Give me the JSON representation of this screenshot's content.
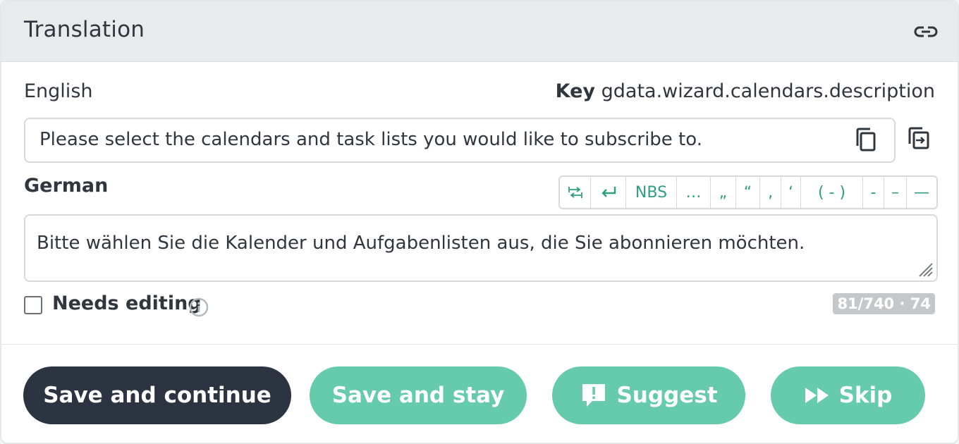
{
  "panel": {
    "title": "Translation",
    "link_icon": "link-icon"
  },
  "source": {
    "language": "English",
    "key_label": "Key",
    "key_value": "gdata.wizard.calendars.description",
    "text": "Please select the calendars and task lists you would like to subscribe to.",
    "copy_icon": "copy-icon",
    "clone_icon": "clone-to-target-icon"
  },
  "target": {
    "language": "German",
    "text": "Bitte wählen Sie die Kalender und Aufgabenlisten aus, die Sie abonnieren möchten.",
    "toolbar": [
      "⭾",
      "↵",
      "NBS",
      "…",
      "„",
      "“",
      "‚",
      "‘",
      "( - )",
      "-",
      "–",
      "—"
    ]
  },
  "status": {
    "needs_editing_label": "Needs editing",
    "needs_editing_checked": false,
    "counter": "81/740 · 74"
  },
  "actions": {
    "save_continue": "Save and continue",
    "save_stay": "Save and stay",
    "suggest": "Suggest",
    "skip": "Skip"
  },
  "colors": {
    "accent_green": "#66cbaa",
    "dark_button": "#2b3440",
    "toolbar_text": "#2ea07d"
  }
}
